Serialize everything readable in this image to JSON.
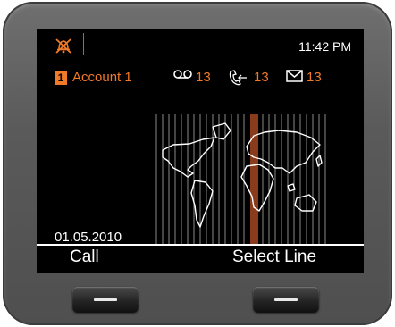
{
  "status_bar": {
    "time": "11:42 PM",
    "bell_icon": "bell-muted-icon"
  },
  "account": {
    "number": "1",
    "name": "Account 1"
  },
  "counters": [
    {
      "icon": "voicemail-icon",
      "value": "13"
    },
    {
      "icon": "missed-call-icon",
      "value": "13"
    },
    {
      "icon": "message-icon",
      "value": "13"
    }
  ],
  "wallpaper": {
    "icon": "world-map-icon"
  },
  "date": "01.05.2010",
  "softkeys": {
    "left": "Call",
    "right": "Select Line"
  },
  "colors": {
    "accent": "#f07a28",
    "screen_bg": "#000000",
    "device_body": "#5c5c5c",
    "map_band": "#8a3b1c"
  }
}
